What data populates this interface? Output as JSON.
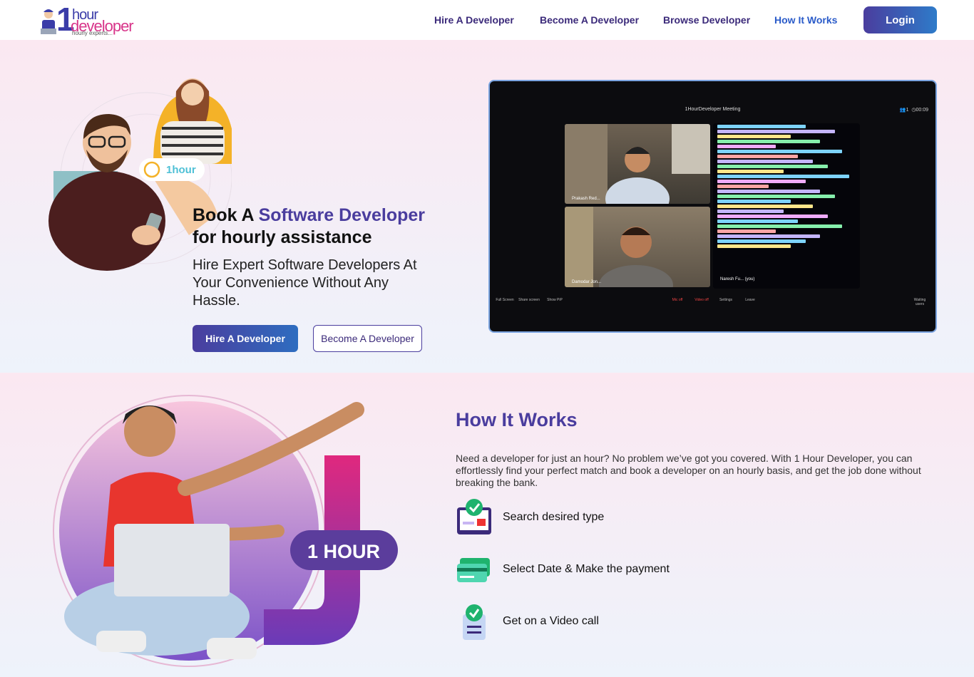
{
  "brand": {
    "one": "1",
    "hour": "hour",
    "developer": "developer",
    "tagline": "hourly experts..."
  },
  "nav": {
    "items": [
      {
        "label": "Hire A Developer"
      },
      {
        "label": "Become A Developer"
      },
      {
        "label": "Browse Developer"
      },
      {
        "label": "How It Works"
      }
    ],
    "login": "Login"
  },
  "hero": {
    "badge": "1hour",
    "title_prefix": "Book A ",
    "title_accent": "Software Developer",
    "title_line2": "for hourly assistance",
    "subtitle": "Hire Expert Software Developers At Your Convenience Without Any Hassle.",
    "cta_primary": "Hire A Developer",
    "cta_secondary": "Become A Developer"
  },
  "video": {
    "title": "1HourDeveloper Meeting",
    "participants": "1",
    "timer": "00:09",
    "tiles": [
      {
        "name": "Prakash Red..."
      },
      {
        "name": "Damodar Jon..."
      },
      {
        "name": "Naresh Fu... (you)"
      }
    ],
    "toolbar": [
      "Full Screen",
      "Share screen",
      "Show PiP",
      "Mic off",
      "Video off",
      "Settings",
      "Leave",
      "Waiting users"
    ]
  },
  "how": {
    "title": "How It Works",
    "badge": "1 HOUR",
    "description": "Need a developer for just an hour? No problem we’ve got you covered. With 1 Hour Developer, you can effortlessly find your perfect match and book a developer on an hourly basis, and get the job done without breaking the bank.",
    "steps": [
      {
        "label": "Search desired type",
        "icon": "search-type-icon"
      },
      {
        "label": "Select Date & Make the payment",
        "icon": "payment-cards-icon"
      },
      {
        "label": "Get on a Video call",
        "icon": "video-call-badge-icon"
      }
    ]
  },
  "colors": {
    "primary": "#4a3d9e",
    "accent_pink": "#d8358a",
    "link_blue": "#2a5bc9"
  }
}
